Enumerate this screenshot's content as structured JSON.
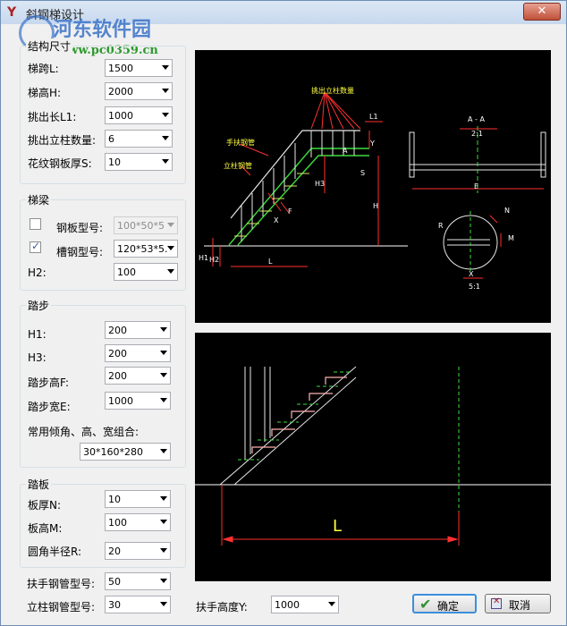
{
  "window": {
    "title": "斜钢梯设计",
    "close_label": "✕"
  },
  "watermark": {
    "name": "河东软件园",
    "url": "www.pc0359.cn"
  },
  "structure": {
    "title": "结构尺寸",
    "fields": [
      {
        "label": "梯跨L:",
        "value": "1500"
      },
      {
        "label": "梯高H:",
        "value": "2000"
      },
      {
        "label": "挑出长L1:",
        "value": "1000"
      },
      {
        "label": "挑出立柱数量:",
        "value": "6"
      },
      {
        "label": "花纹钢板厚S:",
        "value": "10"
      }
    ]
  },
  "beam": {
    "title": "梯梁",
    "plate_label": "钢板型号:",
    "plate_value": "100*50*5",
    "plate_checked": false,
    "channel_label": "槽钢型号:",
    "channel_value": "120*53*5.",
    "channel_checked": true,
    "h2_label": "H2:",
    "h2_value": "100"
  },
  "step": {
    "title": "踏步",
    "fields": [
      {
        "label": "H1:",
        "value": "200"
      },
      {
        "label": "H3:",
        "value": "200"
      },
      {
        "label": "踏步高F:",
        "value": "200"
      },
      {
        "label": "踏步宽E:",
        "value": "1000"
      }
    ],
    "combo_label": "常用倾角、高、宽组合:",
    "combo_value": "30*160*280"
  },
  "plate": {
    "title": "踏板",
    "fields": [
      {
        "label": "板厚N:",
        "value": "10"
      },
      {
        "label": "板高M:",
        "value": "100"
      },
      {
        "label": "圆角半径R:",
        "value": "20"
      }
    ]
  },
  "handrail": {
    "pipe_label": "扶手钢管型号:",
    "pipe_value": "50",
    "post_label": "立柱钢管型号:",
    "post_value": "30",
    "height_label": "扶手高度Y:",
    "height_value": "1000"
  },
  "buttons": {
    "ok": "确定",
    "cancel": "取消"
  },
  "drawing_top": {
    "annotations": {
      "posts_note": "挑出立柱数量",
      "handrail_pipe": "手扶钢管",
      "post_pipe": "立柱钢管",
      "L1": "L1",
      "Y": "Y",
      "S": "S",
      "A": "A",
      "H3": "H3",
      "H": "H",
      "F": "F",
      "X": "X",
      "H1": "H1",
      "H2": "H2",
      "L": "L",
      "section": "A - A",
      "section_scale": "2:1",
      "E": "E",
      "detail_N": "N",
      "detail_M": "M",
      "detail_R": "R",
      "detail_X": "X",
      "detail_scale": "5:1"
    }
  },
  "drawing_bottom": {
    "annotations": {
      "L": "L"
    }
  }
}
